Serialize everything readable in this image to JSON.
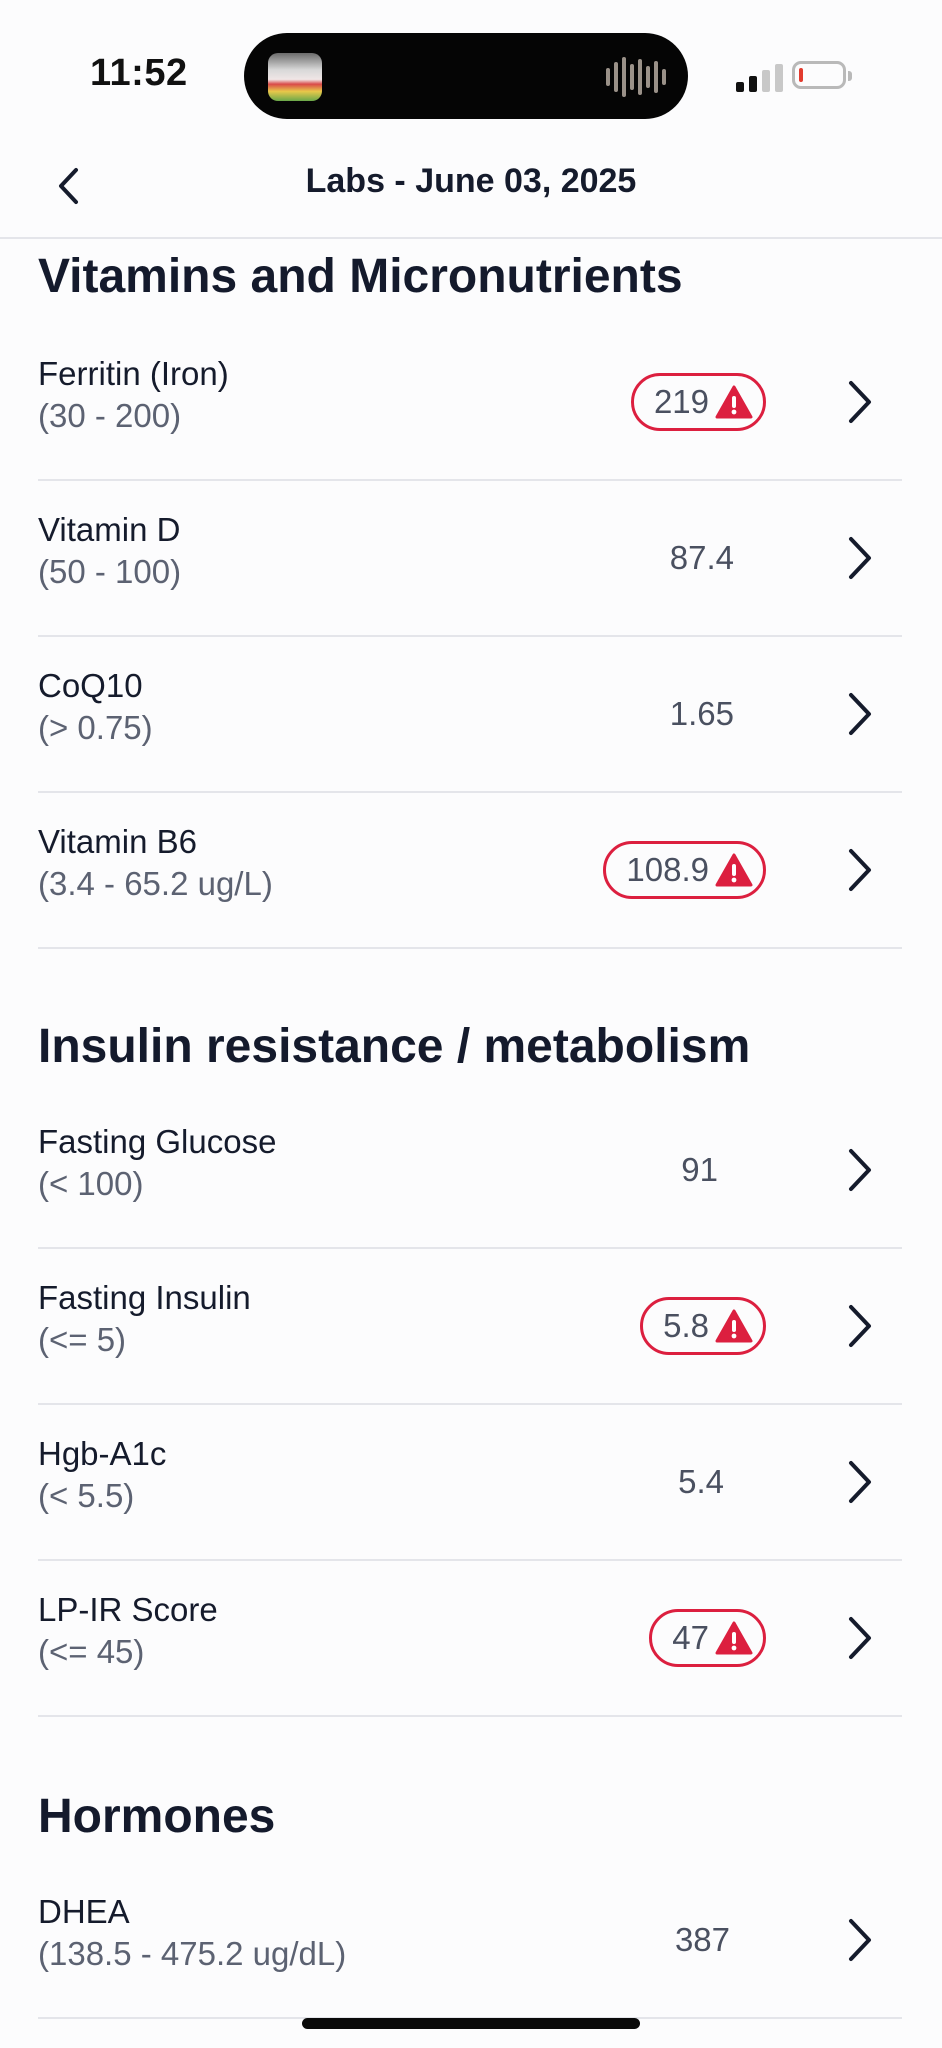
{
  "status_bar": {
    "time": "11:52"
  },
  "nav": {
    "title": "Labs - June 03, 2025"
  },
  "colors": {
    "alert": "#dc1f3f",
    "text": "#151b2c",
    "muted": "#5c6272"
  },
  "sections": [
    {
      "title": "Vitamins and Micronutrients",
      "rows": [
        {
          "name": "Ferritin (Iron)",
          "range": "(30 - 200)",
          "value": "219",
          "flagged": true
        },
        {
          "name": "Vitamin D",
          "range": "(50 - 100)",
          "value": "87.4",
          "flagged": false
        },
        {
          "name": "CoQ10",
          "range": "(> 0.75)",
          "value": "1.65",
          "flagged": false
        },
        {
          "name": "Vitamin B6",
          "range": "(3.4 - 65.2 ug/L)",
          "value": "108.9",
          "flagged": true
        }
      ]
    },
    {
      "title": "Insulin resistance / metabolism",
      "rows": [
        {
          "name": "Fasting Glucose",
          "range": "(< 100)",
          "value": "91",
          "flagged": false
        },
        {
          "name": "Fasting Insulin",
          "range": "(<= 5)",
          "value": "5.8",
          "flagged": true
        },
        {
          "name": "Hgb-A1c",
          "range": "(< 5.5)",
          "value": "5.4",
          "flagged": false
        },
        {
          "name": "LP-IR Score",
          "range": "(<= 45)",
          "value": "47",
          "flagged": true
        }
      ]
    },
    {
      "title": "Hormones",
      "rows": [
        {
          "name": "DHEA",
          "range": "(138.5 - 475.2 ug/dL)",
          "value": "387",
          "flagged": false
        }
      ]
    }
  ]
}
